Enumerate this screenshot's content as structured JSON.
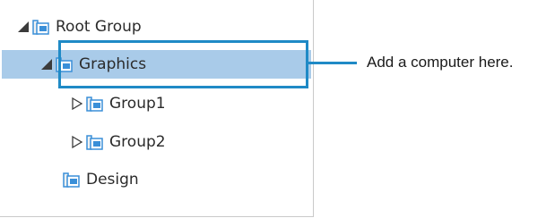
{
  "tree": {
    "items": [
      {
        "label": "Root Group",
        "expanded": true,
        "selected": false
      },
      {
        "label": "Graphics",
        "expanded": true,
        "selected": true
      },
      {
        "label": "Group1",
        "expanded": false,
        "selected": false
      },
      {
        "label": "Group2",
        "expanded": false,
        "selected": false
      },
      {
        "label": "Design",
        "expanded": null,
        "selected": false
      }
    ]
  },
  "callout": {
    "text": "Add a computer here."
  },
  "colors": {
    "selection_fill": "#a9cbe9",
    "highlight_border": "#1f8ac6",
    "folder_blue": "#3a8fd8"
  },
  "icons": {
    "expanded_toggle": "triangle-filled-icon",
    "collapsed_toggle": "triangle-outline-icon",
    "group": "group-folder-icon"
  }
}
